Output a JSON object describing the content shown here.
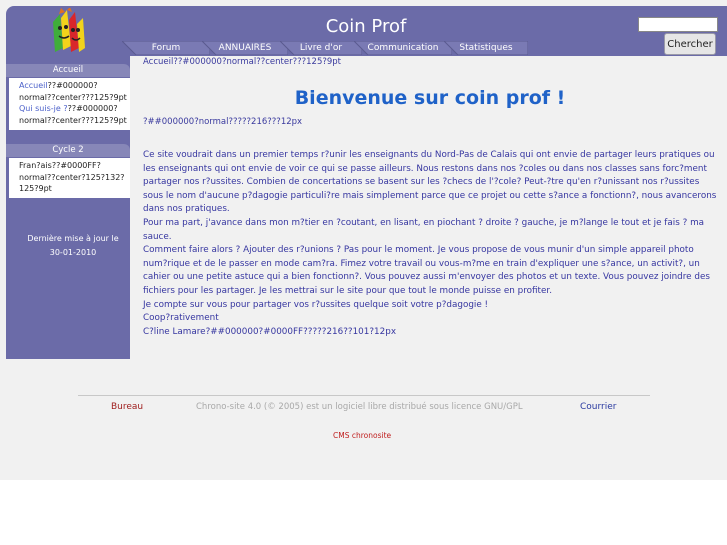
{
  "header": {
    "site_title": "Coin Prof",
    "search_placeholder": "",
    "search_button": "Chercher"
  },
  "nav": {
    "tabs": [
      "Forum",
      "ANNUAIRES",
      "Livre d'or",
      "Communication",
      "Statistiques"
    ]
  },
  "sidebar": {
    "section1_title": "Accueil",
    "section1_items": [
      {
        "link": "Accueil",
        "rest": "??#000000?normal??center???125?9pt"
      },
      {
        "link": "Qui suis-je ?",
        "rest": "??#000000?normal??center???125?9pt"
      }
    ],
    "section2_title": "Cycle 2",
    "section2_text": "Fran?ais??#0000FF?normal??center?125?132?125?9pt",
    "updated_label": "Dernière mise à jour le",
    "updated_date": "30-01-2010"
  },
  "main": {
    "breadcrumb": "Accueil??#000000?normal??center???125?9pt",
    "heading": "Bienvenue sur coin prof !",
    "subline": "?##000000?normal?????216???12px",
    "paragraphs": [
      "Ce site voudrait dans un premier temps r?unir les enseignants du Nord-Pas de Calais qui ont envie de partager leurs pratiques ou les enseignants qui ont envie de voir ce qui se passe ailleurs. Nous restons dans nos ?coles ou dans nos classes sans forc?ment partager nos r?ussites. Combien de concertations se basent sur les ?checs de l'?cole? Peut-?tre qu'en r?unissant nos r?ussites sous le nom d'aucune p?dagogie particuli?re mais simplement parce que ce projet ou cette s?ance a fonctionn?, nous avancerons dans nos pratiques.",
      "Pour ma part, j'avance dans mon m?tier en ?coutant, en lisant, en piochant ? droite ? gauche, je m?lange le tout et je fais ? ma sauce.",
      "Comment faire alors ? Ajouter des r?unions ? Pas pour le moment. Je vous propose de vous munir d'un simple appareil photo num?rique et de le passer en mode cam?ra. Fimez votre travail ou vous-m?me en train d'expliquer une s?ance, un activit?, un cahier ou une petite astuce qui a bien fonctionn?. Vous pouvez aussi m'envoyer des photos et un texte. Vous pouvez joindre des fichiers pour les partager. Je les mettrai sur le site pour que tout le monde puisse en profiter.",
      "Je compte sur vous pour partager vos r?ussites quelque soit votre p?dagogie !",
      "Coop?rativement",
      "C?line Lamare?##000000?#0000FF?????216??101?12px"
    ]
  },
  "footer": {
    "bureau": "Bureau",
    "credit": "Chrono-site 4.0 (© 2005) est un logiciel libre distribué sous licence GNU/GPL",
    "courrier": "Courrier",
    "cms": "CMS chronosite"
  },
  "colors": {
    "header_bg": "#6b6ba8",
    "heading": "#1f62c8",
    "body_text": "#3636a0"
  }
}
